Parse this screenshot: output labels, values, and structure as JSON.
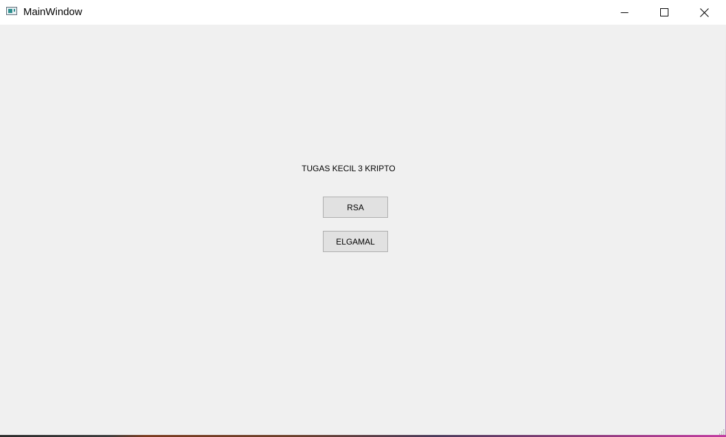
{
  "window": {
    "title": "MainWindow",
    "icon": "app-window-icon"
  },
  "title_controls": {
    "minimize_icon": "minimize-icon",
    "maximize_icon": "maximize-icon",
    "close_icon": "close-icon"
  },
  "content": {
    "heading": "TUGAS KECIL 3 KRIPTO",
    "buttons": [
      {
        "label": "RSA"
      },
      {
        "label": "ELGAMAL"
      }
    ]
  },
  "colors": {
    "background": "#f0f0f0",
    "titlebar": "#ffffff",
    "button_face": "#e1e1e1",
    "button_border": "#adadad"
  }
}
